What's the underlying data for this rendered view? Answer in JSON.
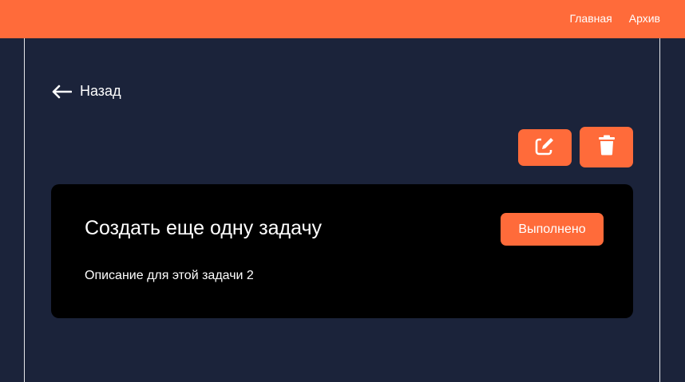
{
  "colors": {
    "accent": "#ff6b3a",
    "background": "#1b233a",
    "card": "#000000",
    "text": "#ffffff"
  },
  "nav": {
    "items": [
      {
        "label": "Главная"
      },
      {
        "label": "Архив"
      }
    ]
  },
  "back": {
    "label": "Назад",
    "icon": "arrow-left-icon"
  },
  "actions": {
    "edit_icon": "pencil-square-icon",
    "delete_icon": "trash-icon"
  },
  "task": {
    "title": "Создать еще одну задачу",
    "description": "Описание для этой задачи 2",
    "status_button": "Выполнено"
  }
}
